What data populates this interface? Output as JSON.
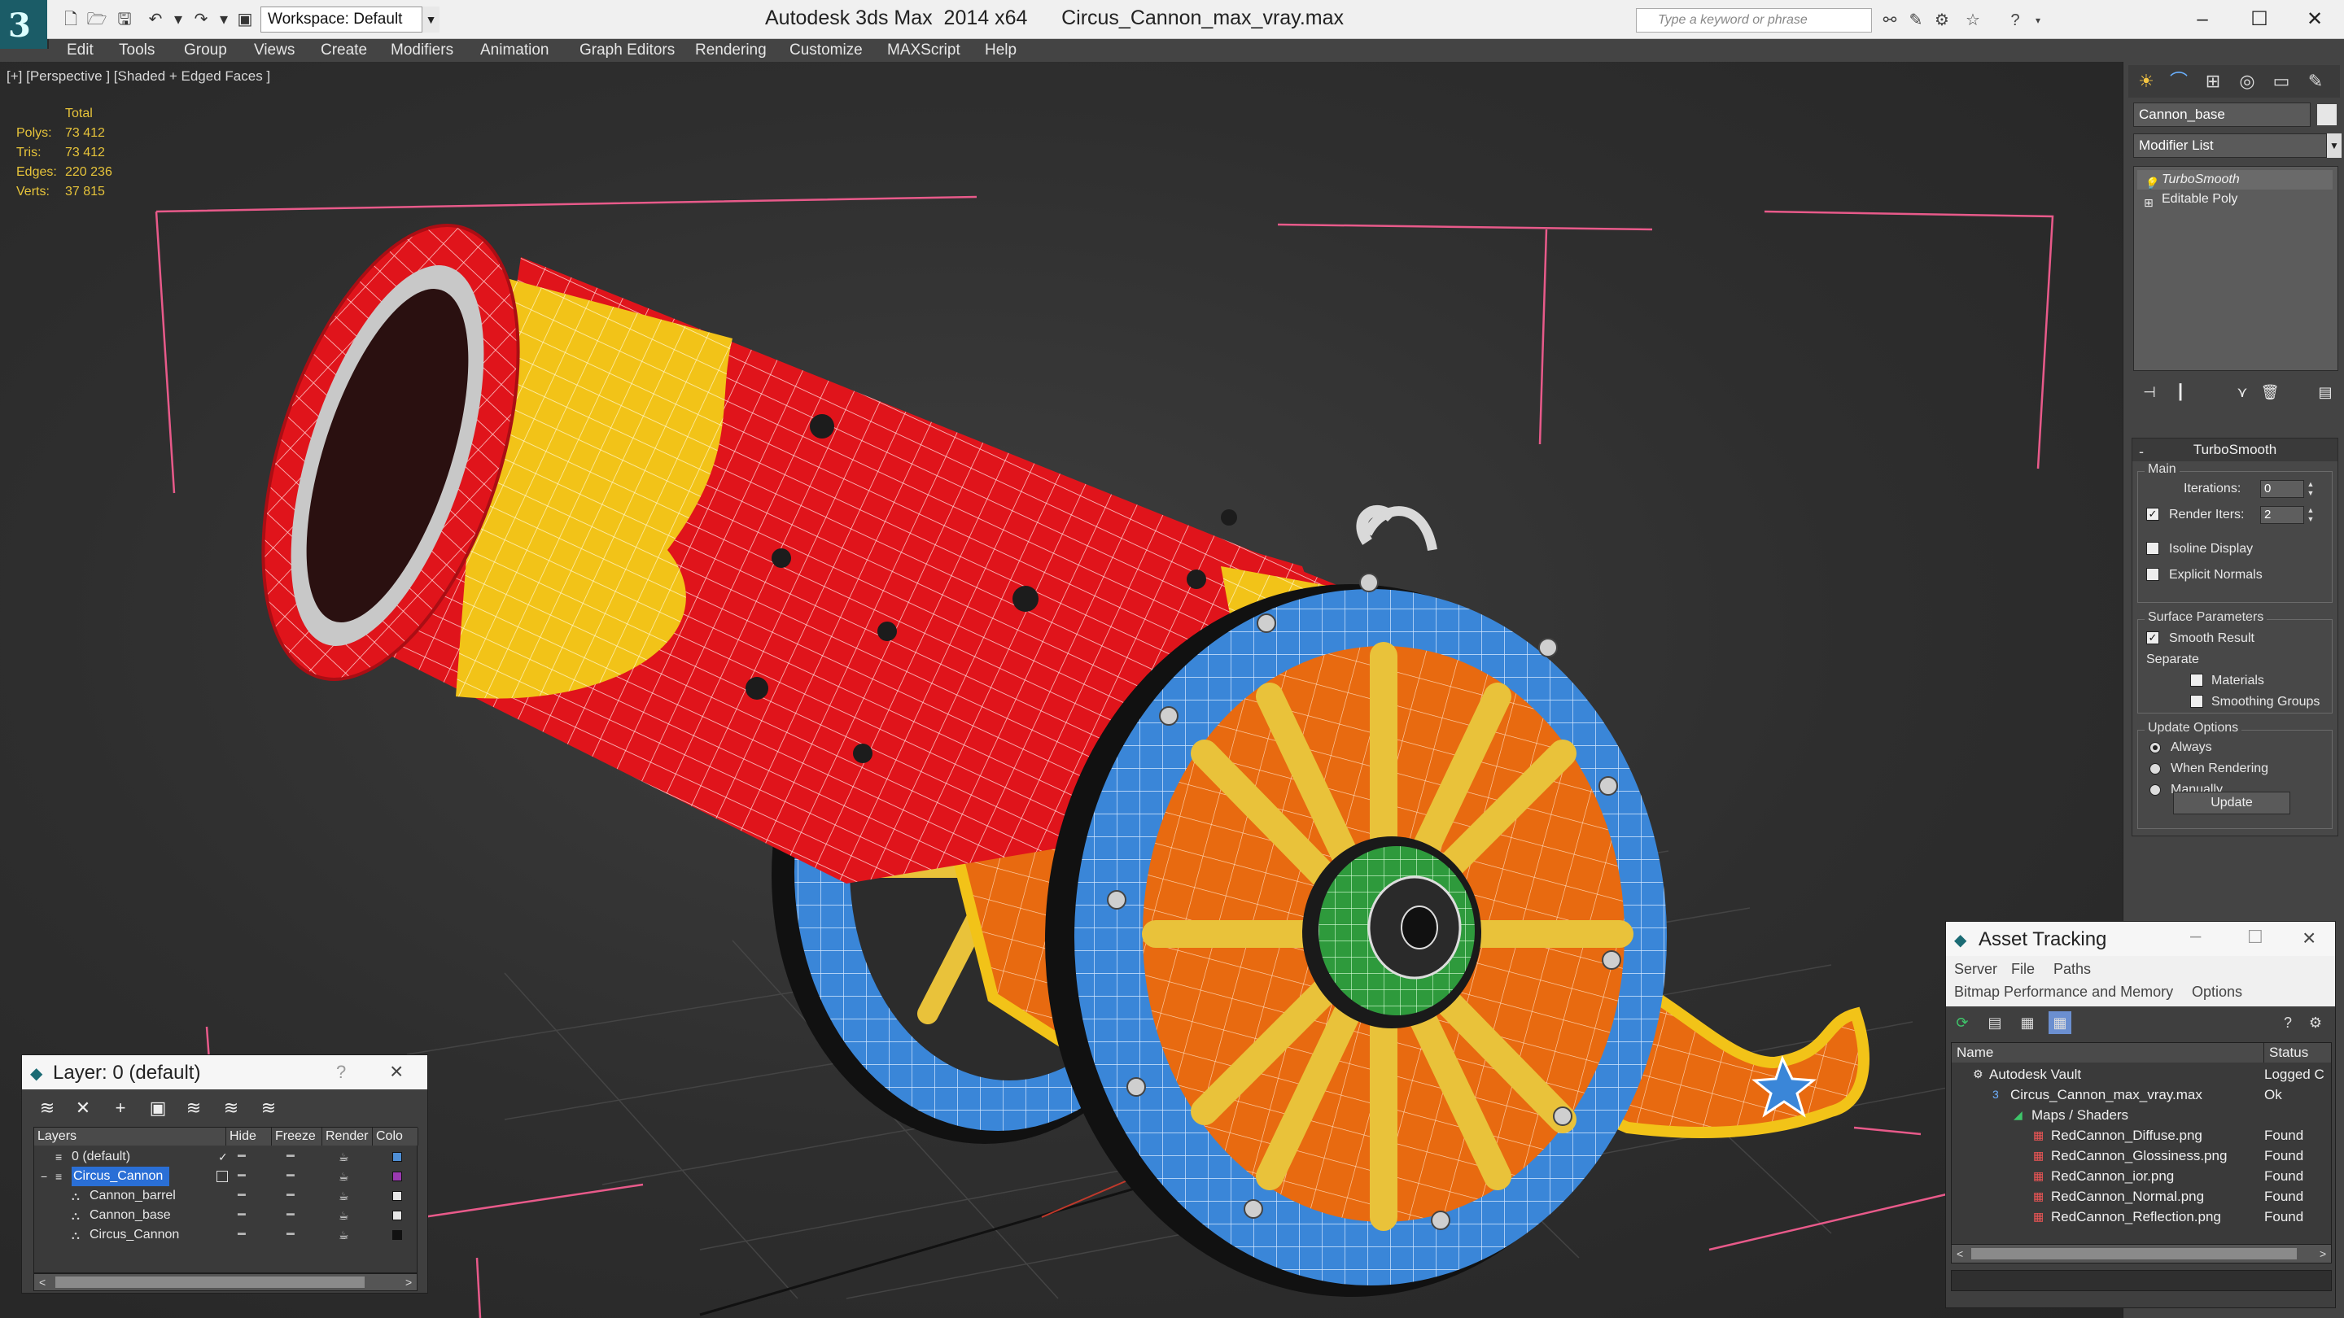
{
  "window": {
    "title": "Autodesk 3ds Max  2014 x64      Circus_Cannon_max_vray.max",
    "workspace": "Workspace: Default",
    "search_placeholder": "Type a keyword or phrase"
  },
  "menu": [
    "Edit",
    "Tools",
    "Group",
    "Views",
    "Create",
    "Modifiers",
    "Animation",
    "Graph Editors",
    "Rendering",
    "Customize",
    "MAXScript",
    "Help"
  ],
  "viewport": {
    "label": "[+] [Perspective ] [Shaded + Edged Faces ]",
    "stats": {
      "header": "Total",
      "rows": [
        {
          "label": "Polys:",
          "value": "73 412"
        },
        {
          "label": "Tris:",
          "value": "73 412"
        },
        {
          "label": "Edges:",
          "value": "220 236"
        },
        {
          "label": "Verts:",
          "value": "37 815"
        }
      ]
    }
  },
  "command_panel": {
    "object_name": "Cannon_base",
    "modifier_list": "Modifier List",
    "stack": [
      "TurboSmooth",
      "Editable Poly"
    ],
    "turbosmooth": {
      "title": "TurboSmooth",
      "main_label": "Main",
      "iterations_label": "Iterations:",
      "iterations_value": "0",
      "render_iters_label": "Render Iters:",
      "render_iters_value": "2",
      "render_iters_checked": true,
      "isoline_label": "Isoline Display",
      "explicit_normals_label": "Explicit Normals",
      "surface_params_label": "Surface Parameters",
      "smooth_result_label": "Smooth Result",
      "separate_label": "Separate",
      "materials_label": "Materials",
      "smoothing_groups_label": "Smoothing Groups",
      "update_options_label": "Update Options",
      "always_label": "Always",
      "when_rendering_label": "When Rendering",
      "manually_label": "Manually",
      "update_button": "Update"
    }
  },
  "layer_dialog": {
    "title": "Layer: 0 (default)",
    "question": "?",
    "columns": [
      "Layers",
      "Hide",
      "Freeze",
      "Render",
      "Colo"
    ],
    "rows": [
      {
        "name": "0 (default)",
        "color": "#4f8fd6",
        "indent": 1
      },
      {
        "name": "Circus_Cannon",
        "color": "#9a3ab0",
        "indent": 1,
        "selected": true
      },
      {
        "name": "Cannon_barrel",
        "color": "#e6e6e6",
        "indent": 2
      },
      {
        "name": "Cannon_base",
        "color": "#e6e6e6",
        "indent": 2
      },
      {
        "name": "Circus_Cannon",
        "color": "#111111",
        "indent": 2
      }
    ]
  },
  "asset_dialog": {
    "title": "Asset Tracking",
    "menu": [
      "Server",
      "File",
      "Paths",
      "Bitmap Performance and Memory",
      "Options"
    ],
    "columns": [
      "Name",
      "Status"
    ],
    "rows": [
      {
        "name": "Autodesk Vault",
        "status": "Logged C",
        "level": 0
      },
      {
        "name": "Circus_Cannon_max_vray.max",
        "status": "Ok",
        "level": 1
      },
      {
        "name": "Maps / Shaders",
        "status": "",
        "level": 2
      },
      {
        "name": "RedCannon_Diffuse.png",
        "status": "Found",
        "level": 3
      },
      {
        "name": "RedCannon_Glossiness.png",
        "status": "Found",
        "level": 3
      },
      {
        "name": "RedCannon_ior.png",
        "status": "Found",
        "level": 3
      },
      {
        "name": "RedCannon_Normal.png",
        "status": "Found",
        "level": 3
      },
      {
        "name": "RedCannon_Reflection.png",
        "status": "Found",
        "level": 3
      }
    ]
  },
  "colors": {
    "barrel_red": "#e0141b",
    "barrel_yellow": "#f2c318",
    "wheel_blue": "#3a86d8",
    "spoke_yellow": "#e9c23a",
    "frame_orange": "#e86a10",
    "hub_green": "#2e9a3c",
    "stats_yellow": "#e7c43a"
  }
}
